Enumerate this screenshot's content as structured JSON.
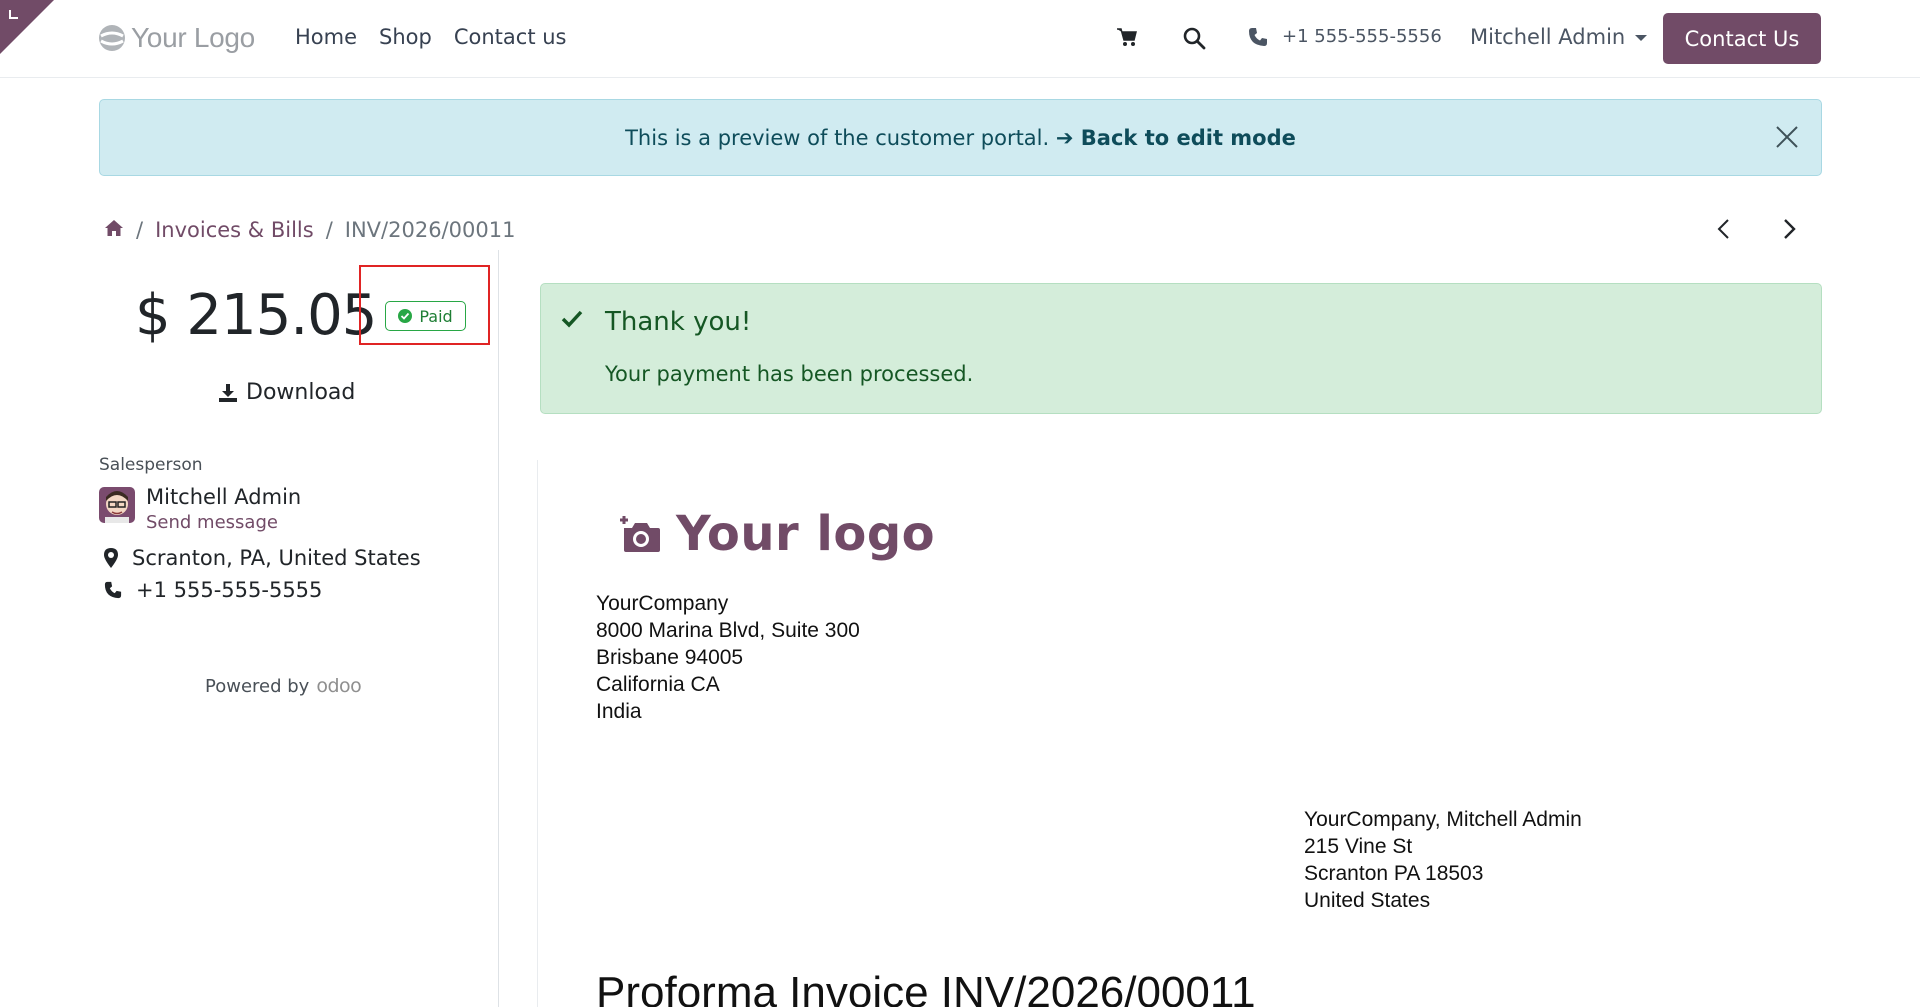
{
  "header": {
    "logo_text": "Your Logo",
    "nav": [
      "Home",
      "Shop",
      "Contact us"
    ],
    "phone": "+1 555-555-5556",
    "user": "Mitchell Admin",
    "contact_button": "Contact Us",
    "icons": [
      "cart-icon",
      "search-icon",
      "phone-icon",
      "chevron-down-icon"
    ]
  },
  "banner": {
    "text": "This is a preview of the customer portal.",
    "link": "➔ Back to edit mode"
  },
  "breadcrumb": {
    "items": [
      "Invoices & Bills",
      "INV/2026/00011"
    ]
  },
  "sidebar": {
    "amount": "$ 215.05",
    "status": "Paid",
    "download": "Download",
    "salesperson_label": "Salesperson",
    "salesperson_name": "Mitchell Admin",
    "send_message": "Send message",
    "location": "Scranton, PA, United States",
    "phone": "+1 555-555-5555",
    "powered_by": "Powered by",
    "powered_brand": "odoo"
  },
  "alert": {
    "title": "Thank you!",
    "message": "Your payment has been processed."
  },
  "document": {
    "logo_text": "Your logo",
    "company_address": [
      "YourCompany",
      "8000 Marina Blvd, Suite 300",
      "Brisbane 94005",
      "California CA",
      "India"
    ],
    "customer_address": [
      "YourCompany, Mitchell Admin",
      "215 Vine St",
      "Scranton PA 18503",
      "United States"
    ],
    "title": "Proforma Invoice INV/2026/00011"
  },
  "colors": {
    "brand": "#714b67",
    "banner_bg": "#d0ebf1",
    "alert_bg": "#d4edda",
    "paid_green": "#28a745",
    "highlight_red": "#e02424"
  }
}
